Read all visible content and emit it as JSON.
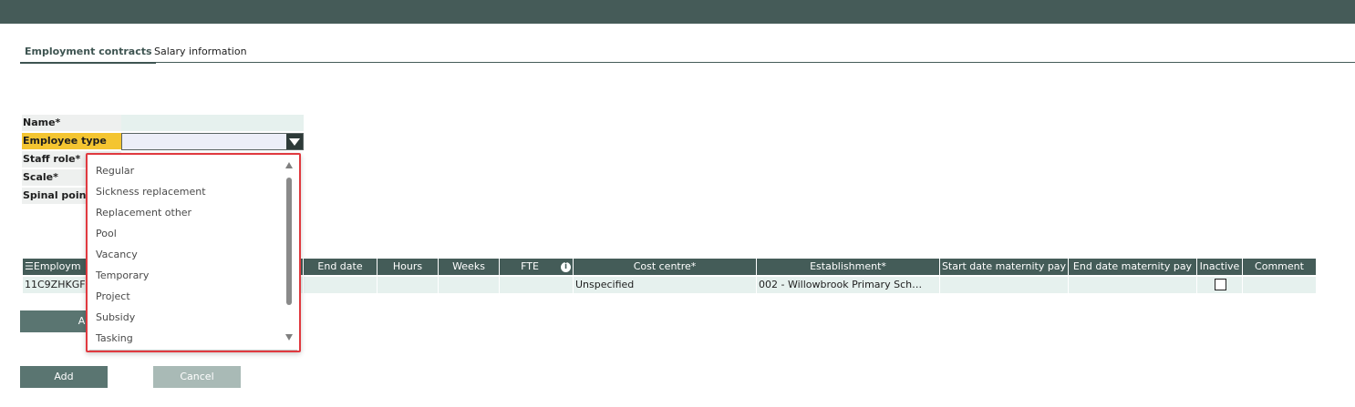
{
  "tabs": [
    {
      "label": "Employment contracts",
      "active": true
    },
    {
      "label": "Salary information",
      "active": false
    }
  ],
  "form": {
    "name_label": "Name*",
    "employee_type_label": "Employee type",
    "staff_role_label": "Staff role*",
    "scale_label": "Scale*",
    "spinal_point_label": "Spinal point"
  },
  "grid": {
    "headers": {
      "employment": "Employm",
      "end_date": "End date",
      "hours": "Hours",
      "weeks": "Weeks",
      "fte": "FTE",
      "cost_centre": "Cost centre*",
      "establishment": "Establishment*",
      "start_maternity": "Start date maternity pay",
      "end_maternity": "End date maternity pay",
      "inactive": "Inactive",
      "comment": "Comment"
    },
    "row": {
      "employment": "11C9ZHKGF",
      "end_date": "",
      "hours": "",
      "weeks": "",
      "fte": "",
      "cost_centre": "Unspecified",
      "establishment": "002 - Willowbrook Primary Sch…",
      "start_maternity": "",
      "end_maternity": "",
      "inactive": false,
      "comment": ""
    }
  },
  "add_row_button_label": "A",
  "buttons": {
    "add": "Add",
    "cancel": "Cancel"
  },
  "dropdown": {
    "options": [
      "Regular",
      "Sickness replacement",
      "Replacement other",
      "Pool",
      "Vacancy",
      "Temporary",
      "Project",
      "Subsidy",
      "Tasking"
    ]
  },
  "colors": {
    "header_bg": "#455b58",
    "accent": "#3e5451",
    "highlight": "#f4c531",
    "row_bg": "#e6f1ee",
    "dropdown_border": "#e0393f"
  }
}
